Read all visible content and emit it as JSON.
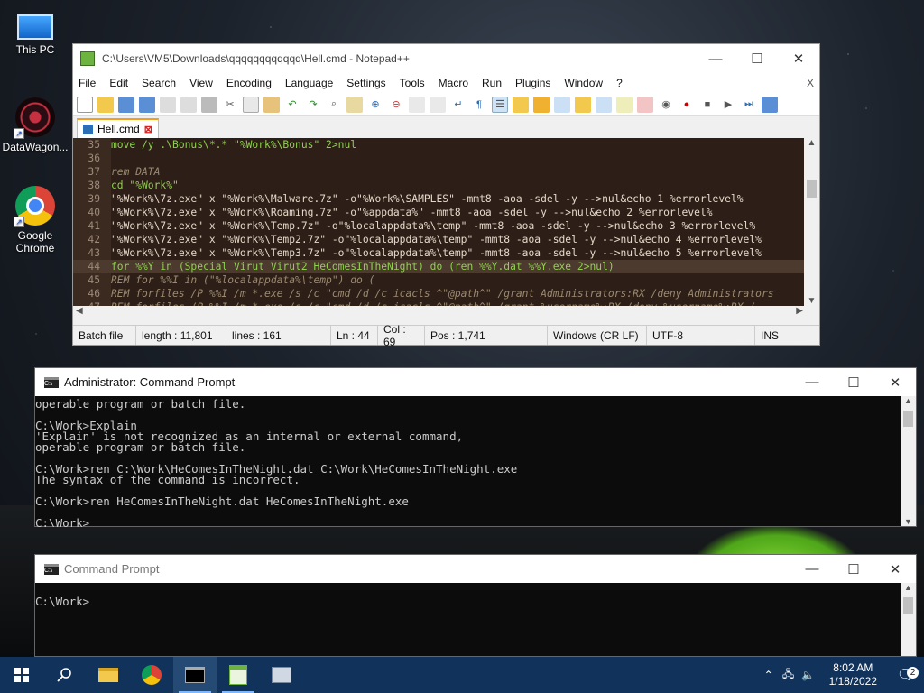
{
  "desktop": {
    "icons": [
      {
        "label": "This PC"
      },
      {
        "label": "DataWagon..."
      },
      {
        "label": "Google\nChrome"
      }
    ]
  },
  "notepad": {
    "title": "C:\\Users\\VM5\\Downloads\\qqqqqqqqqqqq\\Hell.cmd - Notepad++",
    "menu": [
      "File",
      "Edit",
      "Search",
      "View",
      "Encoding",
      "Language",
      "Settings",
      "Tools",
      "Macro",
      "Run",
      "Plugins",
      "Window",
      "?"
    ],
    "menu_close": "X",
    "tab": "Hell.cmd",
    "lines": [
      {
        "n": "35",
        "text": "move /y .\\Bonus\\*.* \"%Work%\\Bonus\" 2>nul",
        "kind": "kw"
      },
      {
        "n": "36",
        "text": "",
        "kind": "plain"
      },
      {
        "n": "37",
        "text": "rem DATA",
        "kind": "rem"
      },
      {
        "n": "38",
        "text": "cd \"%Work%\"",
        "kind": "kw"
      },
      {
        "n": "39",
        "text": "\"%Work%\\7z.exe\" x \"%Work%\\Malware.7z\" -o\"%Work%\\SAMPLES\" -mmt8 -aoa -sdel -y -->nul&echo 1 %errorlevel%",
        "kind": "plain"
      },
      {
        "n": "40",
        "text": "\"%Work%\\7z.exe\" x \"%Work%\\Roaming.7z\" -o\"%appdata%\" -mmt8 -aoa -sdel -y -->nul&echo 2 %errorlevel%",
        "kind": "plain"
      },
      {
        "n": "41",
        "text": "\"%Work%\\7z.exe\" x \"%Work%\\Temp.7z\" -o\"%localappdata%\\temp\" -mmt8 -aoa -sdel -y -->nul&echo 3 %errorlevel%",
        "kind": "plain"
      },
      {
        "n": "42",
        "text": "\"%Work%\\7z.exe\" x \"%Work%\\Temp2.7z\" -o\"%localappdata%\\temp\" -mmt8 -aoa -sdel -y -->nul&echo 4 %errorlevel%",
        "kind": "plain"
      },
      {
        "n": "43",
        "text": "\"%Work%\\7z.exe\" x \"%Work%\\Temp3.7z\" -o\"%localappdata%\\temp\" -mmt8 -aoa -sdel -y -->nul&echo 5 %errorlevel%",
        "kind": "plain"
      },
      {
        "n": "44",
        "text": "for %%Y in (Special Virut Virut2 HeComesInTheNight) do (ren %%Y.dat %%Y.exe 2>nul)",
        "kind": "kw",
        "current": true
      },
      {
        "n": "45",
        "text": "REM for %%I in (\"%localappdata%\\temp\") do (",
        "kind": "rem"
      },
      {
        "n": "46",
        "text": "REM forfiles /P %%I /m *.exe /s /c \"cmd /d /c icacls ^\"@path^\" /grant Administrators:RX /deny Administrators",
        "kind": "rem"
      },
      {
        "n": "47",
        "text": "REM forfiles /P %%I /m *.exe /s /c \"cmd /d /c icacls ^\"@path^\" /grant %username%:RX /deny %username%:RX /",
        "kind": "rem"
      }
    ],
    "status": {
      "type": "Batch file",
      "length": "length : 11,801",
      "lines": "lines : 161",
      "ln": "Ln : 44",
      "col": "Col : 69",
      "pos": "Pos : 1,741",
      "eol": "Windows (CR LF)",
      "encoding": "UTF-8",
      "mode": "INS"
    }
  },
  "cmd_admin": {
    "title": "Administrator: Command Prompt",
    "lines": [
      "operable program or batch file.",
      "",
      "C:\\Work>Explain",
      "'Explain' is not recognized as an internal or external command,",
      "operable program or batch file.",
      "",
      "C:\\Work>ren C:\\Work\\HeComesInTheNight.dat C:\\Work\\HeComesInTheNight.exe",
      "The syntax of the command is incorrect.",
      "",
      "C:\\Work>ren HeComesInTheNight.dat HeComesInTheNight.exe",
      "",
      "C:\\Work>"
    ]
  },
  "cmd_user": {
    "title": "Command Prompt",
    "lines": [
      "",
      "C:\\Work>"
    ]
  },
  "taskbar": {
    "time": "8:02 AM",
    "date": "1/18/2022",
    "notification_count": "2"
  }
}
